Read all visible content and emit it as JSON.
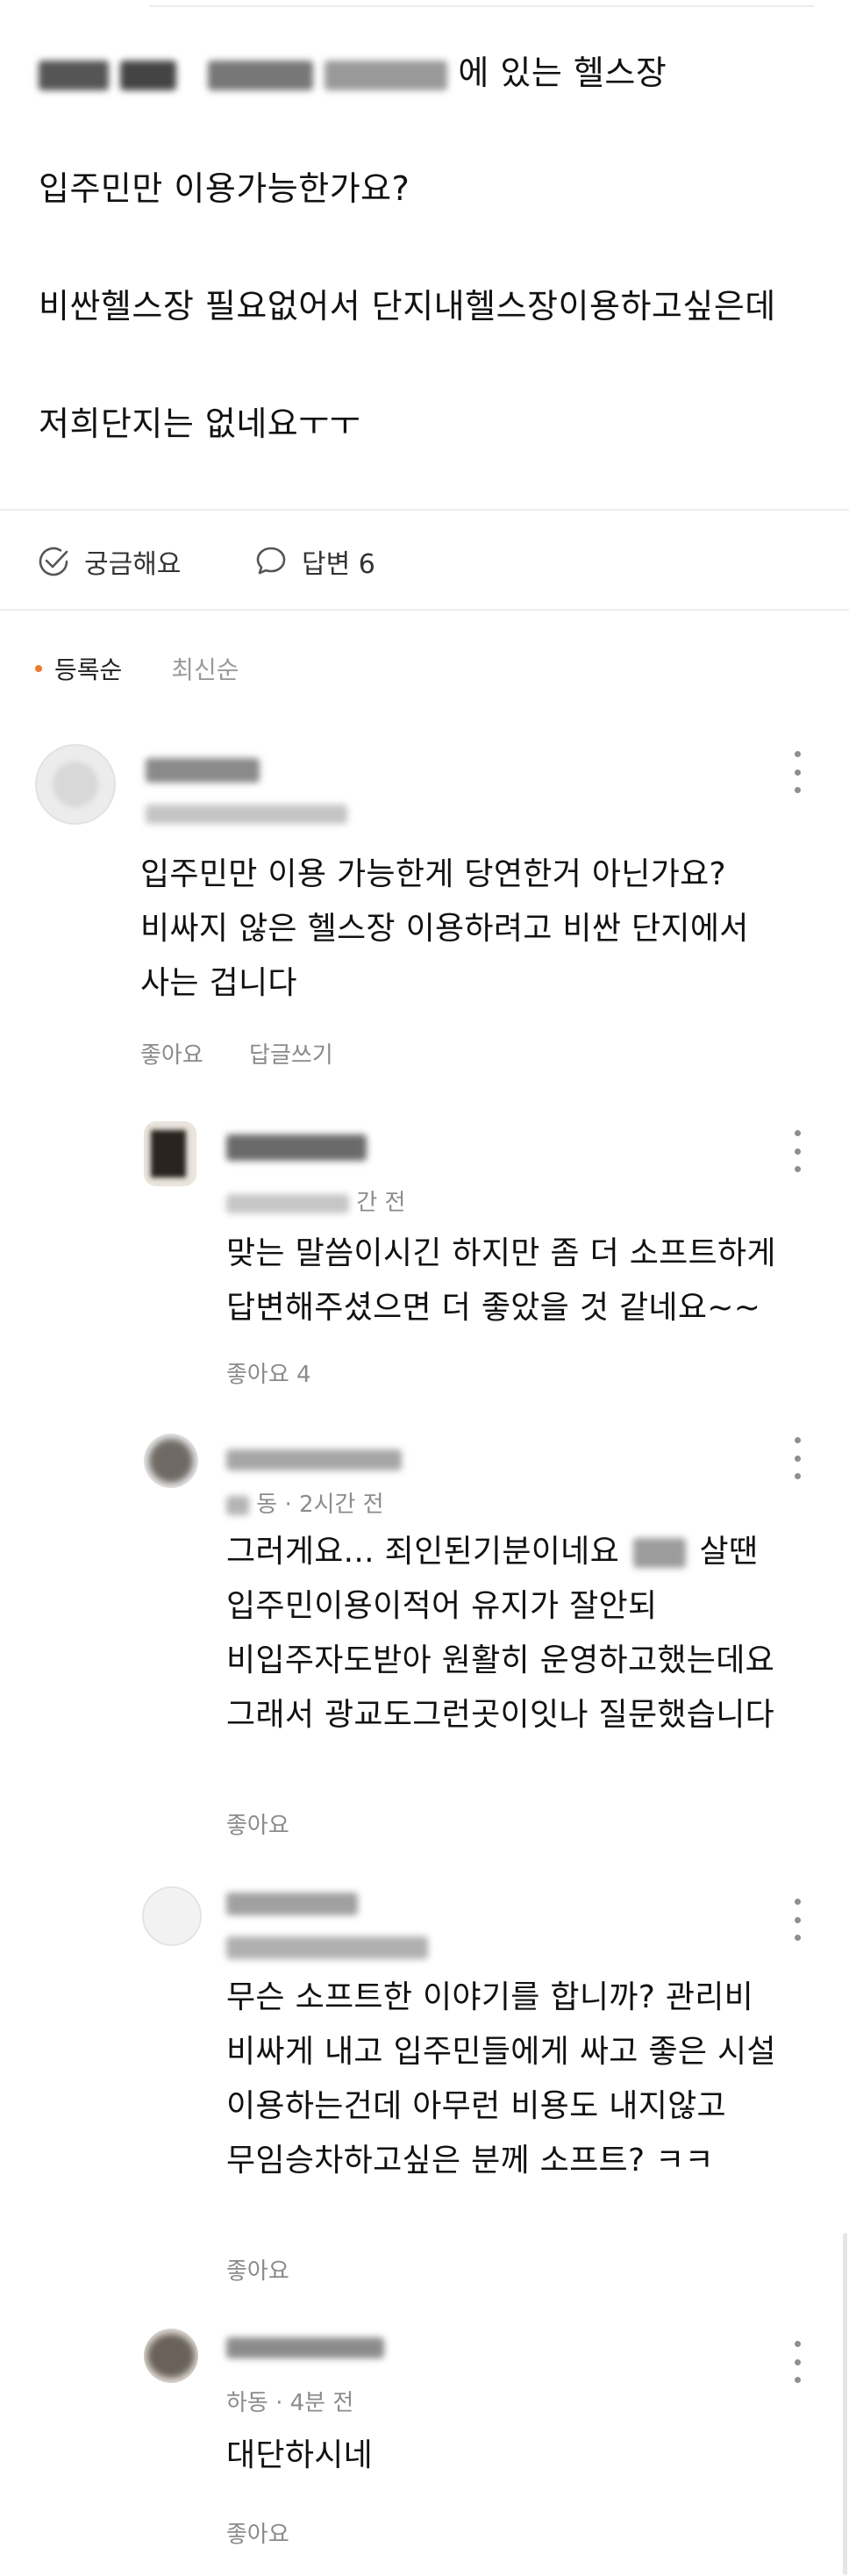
{
  "post": {
    "line1_suffix": "에 있는 헬스장",
    "line2": "입주민만 이용가능한가요?",
    "line3": "비싼헬스장 필요없어서 단지내헬스장이용하고싶은데",
    "line4": "저희단지는 없네요ㅜㅜ"
  },
  "actions": {
    "curious_label": "궁금해요",
    "answer_label": "답변 6"
  },
  "sort": {
    "active": "등록순",
    "inactive": "최신순"
  },
  "comments": [
    {
      "meta": "",
      "lines": [
        "입주민만 이용 가능한게 당연한거 아닌가요?",
        "비싸지 않은 헬스장 이용하려고 비싼 단지에서",
        "사는 겁니다"
      ],
      "like": "좋아요",
      "reply": "답글쓰기"
    },
    {
      "meta": "간 전",
      "lines": [
        "맞는 말씀이시긴 하지만 좀 더 소프트하게",
        "답변해주셨으면 더 좋았을 것 같네요~~"
      ],
      "like": "좋아요 4"
    },
    {
      "meta": "동 · 2시간 전",
      "lines": [
        "그러게요... 죄인된기분이네요",
        "입주민이용이적어 유지가 잘안되",
        "비입주자도받아 원활히 운영하고했는데요",
        "그래서 광교도그런곳이잇나 질문했습니다"
      ],
      "line1_tail": "살땐",
      "like": "좋아요"
    },
    {
      "meta": "",
      "lines": [
        "무슨 소프트한 이야기를 합니까? 관리비",
        "비싸게 내고 입주민들에게 싸고 좋은 시설",
        "이용하는건데 아무런 비용도 내지않고",
        "무임승차하고싶은 분께 소프트? ㅋㅋ"
      ],
      "like": "좋아요"
    },
    {
      "meta": "하동 · 4분 전",
      "lines": [
        "대단하시네"
      ],
      "like": "좋아요"
    }
  ],
  "colors": {
    "accent_dot": "#f07a2d",
    "divider": "#ededed",
    "muted_text": "#8a8a8a"
  }
}
